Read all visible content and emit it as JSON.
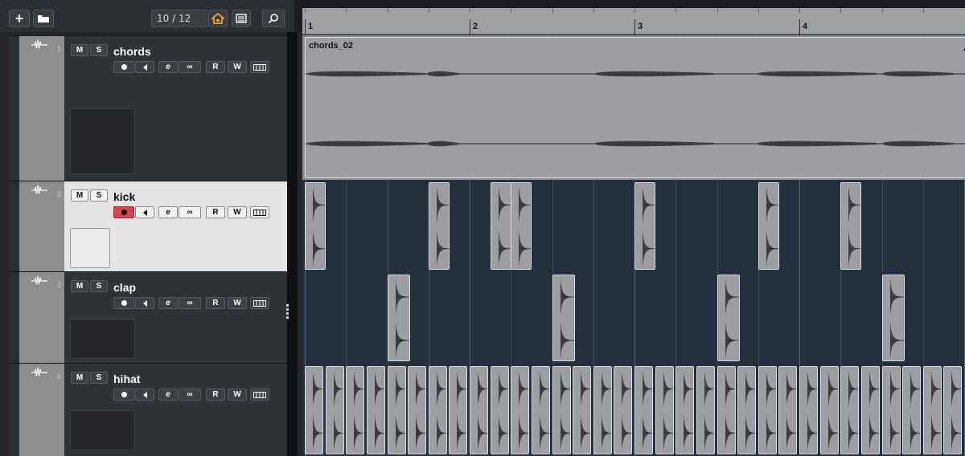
{
  "toolbar": {
    "add_track_icon": "plus-icon",
    "add_folder_icon": "folder-add-icon",
    "counter": "10 / 12",
    "home_icon": "home-icon",
    "list_icon": "list-icon",
    "search_icon": "search-icon"
  },
  "ruler": {
    "bars": [
      "1",
      "2",
      "3",
      "4"
    ]
  },
  "tracks": [
    {
      "number": "1",
      "name": "chords",
      "mute": "M",
      "solo": "S",
      "read": "R",
      "write": "W",
      "selected": false
    },
    {
      "number": "2",
      "name": "kick",
      "mute": "M",
      "solo": "S",
      "read": "R",
      "write": "W",
      "selected": true
    },
    {
      "number": "3",
      "name": "clap",
      "mute": "M",
      "solo": "S",
      "read": "R",
      "write": "W",
      "selected": false
    },
    {
      "number": "4",
      "name": "hihat",
      "mute": "M",
      "solo": "S",
      "read": "R",
      "write": "W",
      "selected": false
    }
  ],
  "clips": {
    "chords": {
      "name": "chords_02",
      "start_beat": 0,
      "length_beats": 16
    },
    "kick_beats": [
      0,
      3,
      4.5,
      5,
      8,
      11,
      13
    ],
    "clap_beats": [
      2,
      6,
      10,
      14
    ],
    "hihat_beats": [
      0,
      0.5,
      1,
      1.5,
      2,
      2.5,
      3,
      3.5,
      4,
      4.5,
      5,
      5.5,
      6,
      6.5,
      7,
      7.5,
      8,
      8.5,
      9,
      9.5,
      10,
      10.5,
      11,
      11.5,
      12,
      12.5,
      13,
      13.5,
      14,
      14.5,
      15,
      15.5
    ]
  },
  "colors": {
    "selected_track": "#e4e4e4",
    "record_armed": "#d8474f",
    "lane_bg": "#243040",
    "clip": "#9c9ea1"
  }
}
